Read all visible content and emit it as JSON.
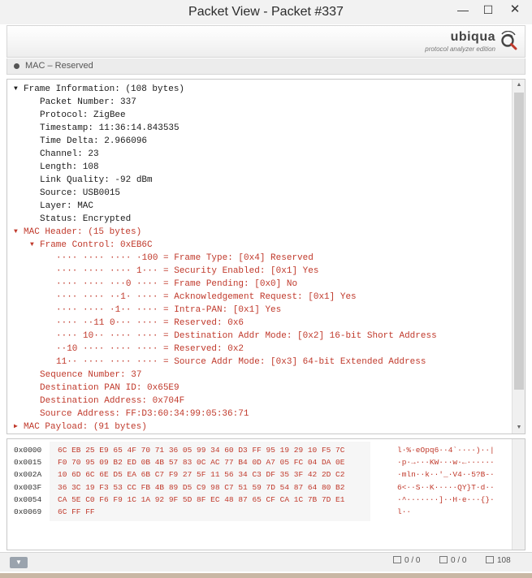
{
  "window": {
    "title": "Packet View - Packet #337",
    "minimize_glyph": "—",
    "maximize_glyph": "☐",
    "close_glyph": "✕"
  },
  "brand": {
    "name": "ubiqua",
    "subtitle": "protocol analyzer edition",
    "logo_icon": "ubiqua-logo-icon",
    "accent_color": "#c0392b"
  },
  "status": {
    "text": "MAC – Reserved"
  },
  "tree_rows": [
    {
      "indent": 0,
      "toggle": "▼",
      "text": "Frame Information: (108 bytes)",
      "color": "black"
    },
    {
      "indent": 1,
      "toggle": "",
      "text": "Packet Number: 337",
      "color": "black"
    },
    {
      "indent": 1,
      "toggle": "",
      "text": "Protocol: ZigBee",
      "color": "black"
    },
    {
      "indent": 1,
      "toggle": "",
      "text": "Timestamp: 11:36:14.843535",
      "color": "black"
    },
    {
      "indent": 1,
      "toggle": "",
      "text": "Time Delta: 2.966096",
      "color": "black"
    },
    {
      "indent": 1,
      "toggle": "",
      "text": "Channel: 23",
      "color": "black"
    },
    {
      "indent": 1,
      "toggle": "",
      "text": "Length: 108",
      "color": "black"
    },
    {
      "indent": 1,
      "toggle": "",
      "text": "Link Quality: -92 dBm",
      "color": "black"
    },
    {
      "indent": 1,
      "toggle": "",
      "text": "Source: USB0015",
      "color": "black"
    },
    {
      "indent": 1,
      "toggle": "",
      "text": "Layer: MAC",
      "color": "black"
    },
    {
      "indent": 1,
      "toggle": "",
      "text": "Status: Encrypted",
      "color": "black"
    },
    {
      "indent": 0,
      "toggle": "▼",
      "text": "MAC Header: (15 bytes)",
      "color": "red"
    },
    {
      "indent": 1,
      "toggle": "▼",
      "text": "Frame Control: 0xEB6C",
      "color": "red"
    },
    {
      "indent": 2,
      "toggle": "",
      "text": "···· ···· ···· ·100 = Frame Type: [0x4] Reserved",
      "color": "red"
    },
    {
      "indent": 2,
      "toggle": "",
      "text": "···· ···· ···· 1··· = Security Enabled: [0x1] Yes",
      "color": "red"
    },
    {
      "indent": 2,
      "toggle": "",
      "text": "···· ···· ···0 ···· = Frame Pending: [0x0] No",
      "color": "red"
    },
    {
      "indent": 2,
      "toggle": "",
      "text": "···· ···· ··1· ···· = Acknowledgement Request: [0x1] Yes",
      "color": "red"
    },
    {
      "indent": 2,
      "toggle": "",
      "text": "···· ···· ·1·· ···· = Intra-PAN: [0x1] Yes",
      "color": "red"
    },
    {
      "indent": 2,
      "toggle": "",
      "text": "···· ··11 0··· ···· = Reserved: 0x6",
      "color": "red"
    },
    {
      "indent": 2,
      "toggle": "",
      "text": "···· 10·· ···· ···· = Destination Addr Mode: [0x2] 16-bit Short Address",
      "color": "red"
    },
    {
      "indent": 2,
      "toggle": "",
      "text": "··10 ···· ···· ···· = Reserved: 0x2",
      "color": "red"
    },
    {
      "indent": 2,
      "toggle": "",
      "text": "11·· ···· ···· ···· = Source Addr Mode: [0x3] 64-bit Extended Address",
      "color": "red"
    },
    {
      "indent": 1,
      "toggle": "",
      "text": "Sequence Number: 37",
      "color": "red"
    },
    {
      "indent": 1,
      "toggle": "",
      "text": "Destination PAN ID: 0x65E9",
      "color": "red"
    },
    {
      "indent": 1,
      "toggle": "",
      "text": "Destination Address: 0x704F",
      "color": "red"
    },
    {
      "indent": 1,
      "toggle": "",
      "text": "Source Address: FF:D3:60:34:99:05:36:71",
      "color": "red"
    },
    {
      "indent": 0,
      "toggle": "▶",
      "text": "MAC Payload: (91 bytes)",
      "color": "red"
    }
  ],
  "hex_rows": [
    {
      "offset": "0x0000",
      "bytes": "6C EB 25 E9 65 4F 70 71 36 05 99 34 60 D3 FF 95 19 29 10 F5 7C",
      "ascii": "l·%·eOpq6··4`····)··|"
    },
    {
      "offset": "0x0015",
      "bytes": "F0 70 95 09 B2 ED 0B 4B 57 83 0C AC 77 B4 0D A7 05 FC 04 DA 0E",
      "ascii": "·p·→···KW···w·←······"
    },
    {
      "offset": "0x002A",
      "bytes": "10 6D 6C 6E D5 EA 6B C7 F9 27 5F 11 56 34 C3 DF 35 3F 42 2D C2",
      "ascii": "·mln··k··'_·V4··5?B-·"
    },
    {
      "offset": "0x003F",
      "bytes": "36 3C 19 F3 53 CC FB 4B 89 D5 C9 98 C7 51 59 7D 54 87 64 80 B2",
      "ascii": "6<··S··K·····QY}T·d··"
    },
    {
      "offset": "0x0054",
      "bytes": "CA 5E C0 F6 F9 1C 1A 92 9F 5D 8F EC 48 87 65 CF CA 1C 7B 7D E1",
      "ascii": "·^·······]··H·e···{}·"
    },
    {
      "offset": "0x0069",
      "bytes": "6C FF FF",
      "ascii": "l··"
    }
  ],
  "bottom": {
    "menu_glyph": "▼",
    "counter1": "0 / 0",
    "counter2": "0 / 0",
    "counter3": "108"
  }
}
